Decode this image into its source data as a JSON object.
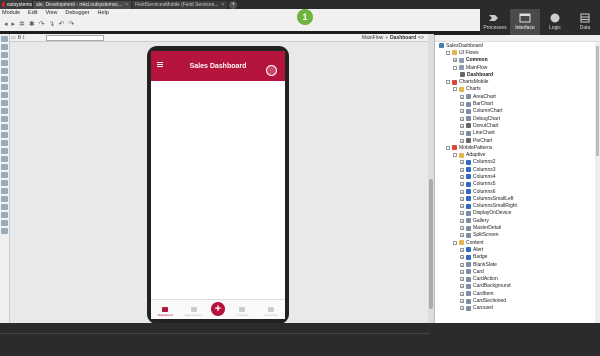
{
  "titlebar": {
    "logo_label": "outsystems",
    "tabs": [
      {
        "label": "ale, Development - mkd.outsystemsc...",
        "active": true
      },
      {
        "label": "FieldServicesMobile (Field Services...",
        "active": false
      }
    ],
    "close_glyph": "×",
    "add_glyph": "+"
  },
  "menubar": {
    "items": [
      "Module",
      "Edit",
      "View",
      "Debugger",
      "Help"
    ]
  },
  "step_badge": "1",
  "right_tabs": [
    {
      "label": "Processes",
      "icon": "processes-icon",
      "active": false
    },
    {
      "label": "Interface",
      "icon": "interface-icon",
      "active": true
    },
    {
      "label": "Logic",
      "icon": "logic-icon",
      "active": false
    },
    {
      "label": "Data",
      "icon": "data-icon",
      "active": false
    }
  ],
  "editor": {
    "breadcrumb_parent": "MainFlow",
    "breadcrumb_sep": "»",
    "breadcrumb_current": "Dashboard",
    "code_toggle": "<>"
  },
  "phone": {
    "header_title": "Sales Dashboard",
    "nav": [
      {
        "label": "Dashboard",
        "active": true
      },
      {
        "label": "Opportunities",
        "active": false
      },
      {
        "label": "",
        "fab": true
      },
      {
        "label": "Contacts",
        "active": false
      },
      {
        "label": "Accounts",
        "active": false
      }
    ],
    "fab_glyph": "+"
  },
  "tree": {
    "rows": [
      {
        "label": "SalesDashboard",
        "indent": 0,
        "icon": "module",
        "exp": "",
        "bold": false
      },
      {
        "label": "UI Flows",
        "indent": 1,
        "icon": "folder",
        "exp": "-",
        "bold": false
      },
      {
        "label": "Common",
        "indent": 2,
        "icon": "flow",
        "exp": "+",
        "bold": true
      },
      {
        "label": "MainFlow",
        "indent": 2,
        "icon": "flow",
        "exp": "-",
        "bold": false
      },
      {
        "label": "Dashboard",
        "indent": 3,
        "icon": "screen",
        "exp": "",
        "bold": true
      },
      {
        "label": "ChartsMobile",
        "indent": 1,
        "icon": "red",
        "exp": "-",
        "bold": false
      },
      {
        "label": "Charts",
        "indent": 2,
        "icon": "folder",
        "exp": "-",
        "bold": false
      },
      {
        "label": "AreaChart",
        "indent": 3,
        "icon": "block",
        "exp": "+",
        "bold": false
      },
      {
        "label": "BarChart",
        "indent": 3,
        "icon": "block",
        "exp": "+",
        "bold": false
      },
      {
        "label": "ColumnChart",
        "indent": 3,
        "icon": "block",
        "exp": "+",
        "bold": false
      },
      {
        "label": "DebugChart",
        "indent": 3,
        "icon": "block",
        "exp": "+",
        "bold": false
      },
      {
        "label": "DonutChart",
        "indent": 3,
        "icon": "screen",
        "exp": "+",
        "bold": false
      },
      {
        "label": "LineChart",
        "indent": 3,
        "icon": "block",
        "exp": "+",
        "bold": false
      },
      {
        "label": "PieChart",
        "indent": 3,
        "icon": "screen",
        "exp": "+",
        "bold": false
      },
      {
        "label": "MobilePatterns",
        "indent": 1,
        "icon": "red",
        "exp": "-",
        "bold": false
      },
      {
        "label": "Adaptive",
        "indent": 2,
        "icon": "folder",
        "exp": "-",
        "bold": false
      },
      {
        "label": "Columns2",
        "indent": 3,
        "icon": "blue",
        "exp": "+",
        "bold": false
      },
      {
        "label": "Columns3",
        "indent": 3,
        "icon": "blue",
        "exp": "+",
        "bold": false
      },
      {
        "label": "Columns4",
        "indent": 3,
        "icon": "blue",
        "exp": "+",
        "bold": false
      },
      {
        "label": "Columns5",
        "indent": 3,
        "icon": "blue",
        "exp": "+",
        "bold": false
      },
      {
        "label": "Columns6",
        "indent": 3,
        "icon": "blue",
        "exp": "+",
        "bold": false
      },
      {
        "label": "ColumnsSmallLeft",
        "indent": 3,
        "icon": "blue",
        "exp": "+",
        "bold": false
      },
      {
        "label": "ColumnsSmallRight",
        "indent": 3,
        "icon": "blue",
        "exp": "+",
        "bold": false
      },
      {
        "label": "DisplayOnDevice",
        "indent": 3,
        "icon": "block",
        "exp": "+",
        "bold": false
      },
      {
        "label": "Gallery",
        "indent": 3,
        "icon": "block",
        "exp": "+",
        "bold": false
      },
      {
        "label": "MasterDetail",
        "indent": 3,
        "icon": "block",
        "exp": "+",
        "bold": false
      },
      {
        "label": "SplitScreen",
        "indent": 3,
        "icon": "block",
        "exp": "+",
        "bold": false
      },
      {
        "label": "Content",
        "indent": 2,
        "icon": "folder",
        "exp": "-",
        "bold": false
      },
      {
        "label": "Alert",
        "indent": 3,
        "icon": "info",
        "exp": "+",
        "bold": false
      },
      {
        "label": "Badge",
        "indent": 3,
        "icon": "info",
        "exp": "+",
        "bold": false
      },
      {
        "label": "BlankSlate",
        "indent": 3,
        "icon": "block",
        "exp": "+",
        "bold": false
      },
      {
        "label": "Card",
        "indent": 3,
        "icon": "block",
        "exp": "+",
        "bold": false
      },
      {
        "label": "CardAction",
        "indent": 3,
        "icon": "block",
        "exp": "+",
        "bold": false
      },
      {
        "label": "CardBackground",
        "indent": 3,
        "icon": "block",
        "exp": "+",
        "bold": false
      },
      {
        "label": "CardItem",
        "indent": 3,
        "icon": "block",
        "exp": "+",
        "bold": false
      },
      {
        "label": "CardSectioned",
        "indent": 3,
        "icon": "block",
        "exp": "+",
        "bold": false
      },
      {
        "label": "Carousel",
        "indent": 3,
        "icon": "block",
        "exp": "+",
        "bold": false
      }
    ]
  },
  "colors": {
    "brand_red": "#b5153c",
    "badge_green": "#6db33f",
    "chrome_dark": "#2b2b2b"
  }
}
